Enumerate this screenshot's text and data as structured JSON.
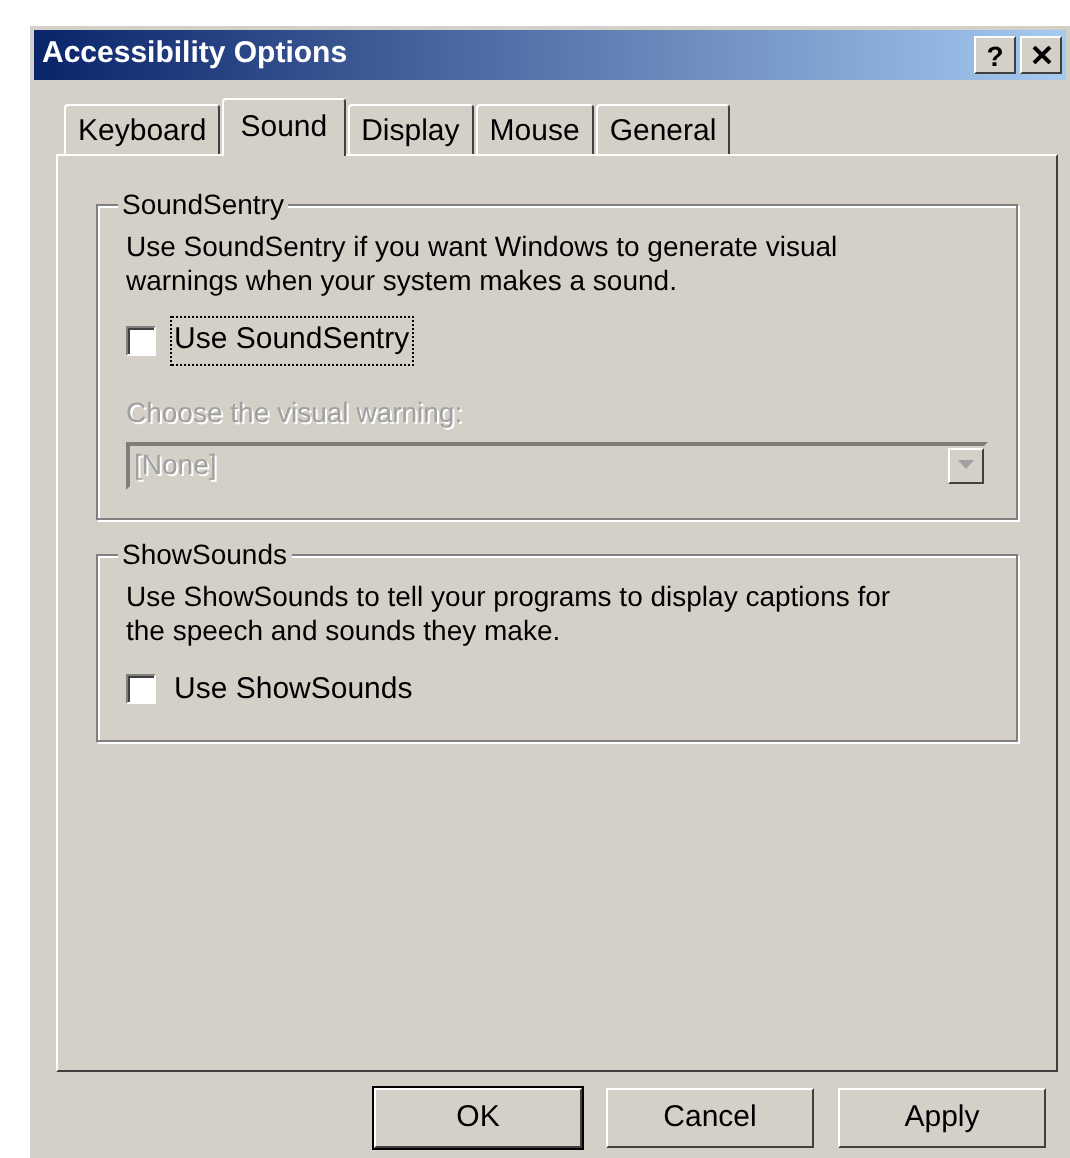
{
  "window": {
    "title": "Accessibility Options",
    "help_button": "?"
  },
  "tabs": [
    {
      "label": "Keyboard",
      "selected": false
    },
    {
      "label": "Sound",
      "selected": true
    },
    {
      "label": "Display",
      "selected": false
    },
    {
      "label": "Mouse",
      "selected": false
    },
    {
      "label": "General",
      "selected": false
    }
  ],
  "groups": [
    {
      "title": "SoundSentry",
      "description": "Use SoundSentry if you want Windows to generate visual warnings when your system makes a sound.",
      "checkbox": {
        "label": "Use SoundSentry",
        "checked": false,
        "focused": true
      },
      "dropdown": {
        "label": "Choose the visual warning:",
        "value": "[None]",
        "disabled": true
      }
    },
    {
      "title": "ShowSounds",
      "description": "Use ShowSounds to tell your programs to display captions for the speech and sounds they make.",
      "checkbox": {
        "label": "Use ShowSounds",
        "checked": false,
        "focused": false
      }
    }
  ],
  "buttons": [
    {
      "label": "OK",
      "default": true
    },
    {
      "label": "Cancel",
      "default": false
    },
    {
      "label": "Apply",
      "default": false
    }
  ]
}
